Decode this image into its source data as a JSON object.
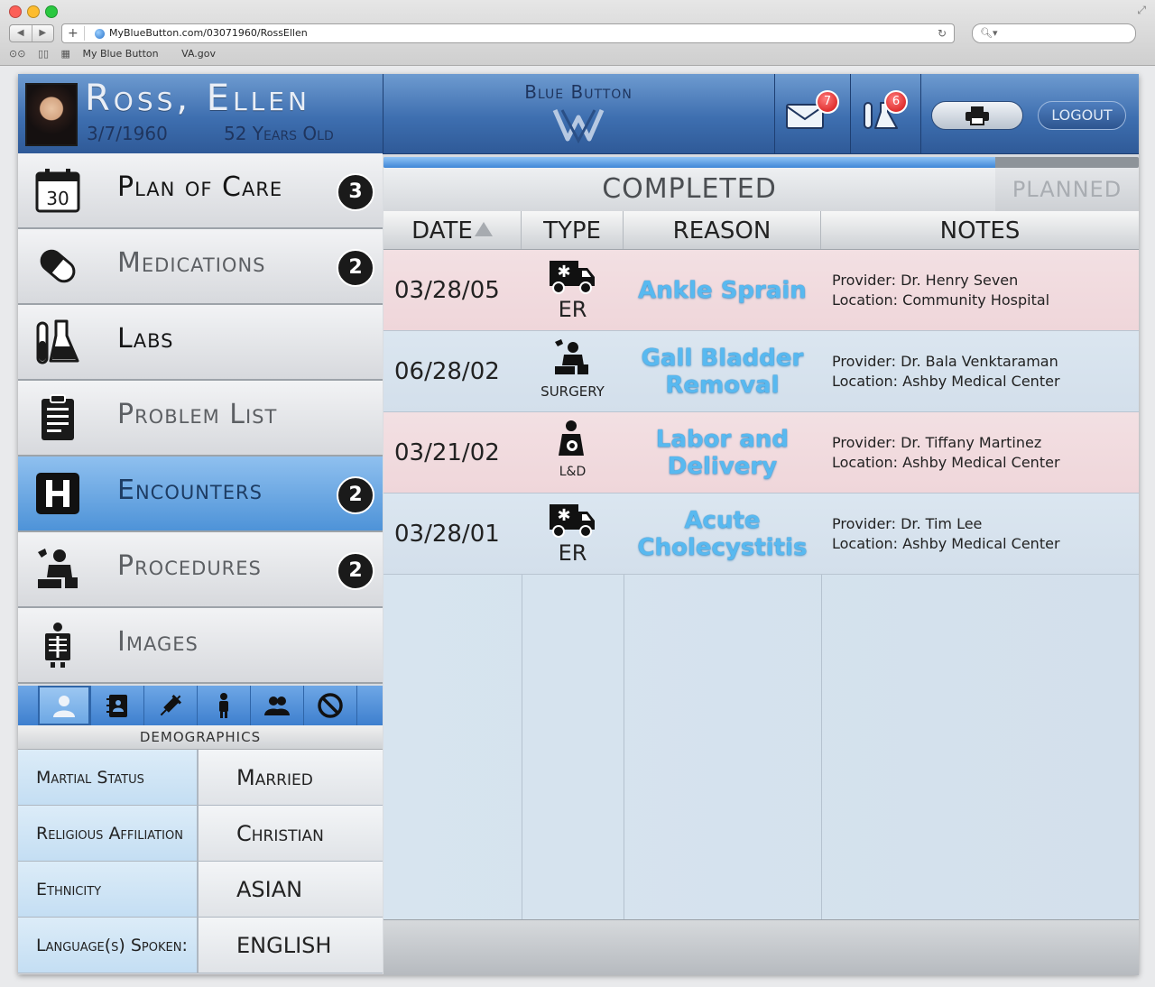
{
  "browser": {
    "url": "MyBlueButton.com/03071960/RossEllen",
    "bookmarks": [
      "My Blue Button",
      "VA.gov"
    ]
  },
  "patient": {
    "name": "Ross, Ellen",
    "dob": "3/7/1960",
    "age": "52 Years Old"
  },
  "brand": {
    "title": "Blue Button"
  },
  "header": {
    "messages_count": "7",
    "labs_count": "6",
    "logout_label": "LOGOUT"
  },
  "menu": {
    "items": [
      {
        "label": "Plan of Care",
        "badge": "3",
        "icon": "calendar-icon"
      },
      {
        "label": "Medications",
        "badge": "2",
        "icon": "pill-icon"
      },
      {
        "label": "Labs",
        "badge": "",
        "icon": "flask-icon"
      },
      {
        "label": "Problem List",
        "badge": "",
        "icon": "clipboard-icon"
      },
      {
        "label": "Encounters",
        "badge": "2",
        "icon": "hospital-icon"
      },
      {
        "label": "Procedures",
        "badge": "2",
        "icon": "surgeon-icon"
      },
      {
        "label": "Images",
        "badge": "",
        "icon": "xray-icon"
      }
    ],
    "calendar_day": "30"
  },
  "demographics": {
    "title": "DEMOGRAPHICS",
    "rows": [
      {
        "label": "Martial Status",
        "value": "Married"
      },
      {
        "label": "Religious Affiliation",
        "value": "Christian"
      },
      {
        "label": "Ethnicity",
        "value": "ASIAN"
      },
      {
        "label": "Language(s) Spoken:",
        "value": "ENGLISH"
      }
    ]
  },
  "encounters": {
    "progress_fraction": 0.81,
    "tab_completed": "COMPLETED",
    "tab_planned": "PLANNED",
    "columns": [
      "DATE",
      "TYPE",
      "REASON",
      "NOTES"
    ],
    "rows": [
      {
        "date": "03/28/05",
        "type": "ER",
        "type_icon": "ambulance-icon",
        "reason": "Ankle Sprain",
        "provider": "Provider: Dr. Henry Seven",
        "location": "Location: Community Hospital"
      },
      {
        "date": "06/28/02",
        "type": "SURGERY",
        "type_icon": "surgeon-icon",
        "reason": "Gall Bladder Removal",
        "provider": "Provider: Dr. Bala Venktaraman",
        "location": "Location: Ashby Medical Center"
      },
      {
        "date": "03/21/02",
        "type": "L&D",
        "type_icon": "pregnant-icon",
        "reason": "Labor and Delivery",
        "provider": "Provider: Dr. Tiffany Martinez",
        "location": "Location: Ashby Medical Center"
      },
      {
        "date": "03/28/01",
        "type": "ER",
        "type_icon": "ambulance-icon",
        "reason": "Acute Cholecystitis",
        "provider": "Provider: Dr. Tim Lee",
        "location": "Location: Ashby Medical Center"
      }
    ]
  },
  "colors": {
    "header_blue": "#3e6fb0",
    "active_blue": "#4e93d8",
    "row_pink": "#f0d8dc",
    "row_blue": "#d6e2ed",
    "reason_text": "#58b9f0",
    "badge_red": "#d20f0f"
  }
}
